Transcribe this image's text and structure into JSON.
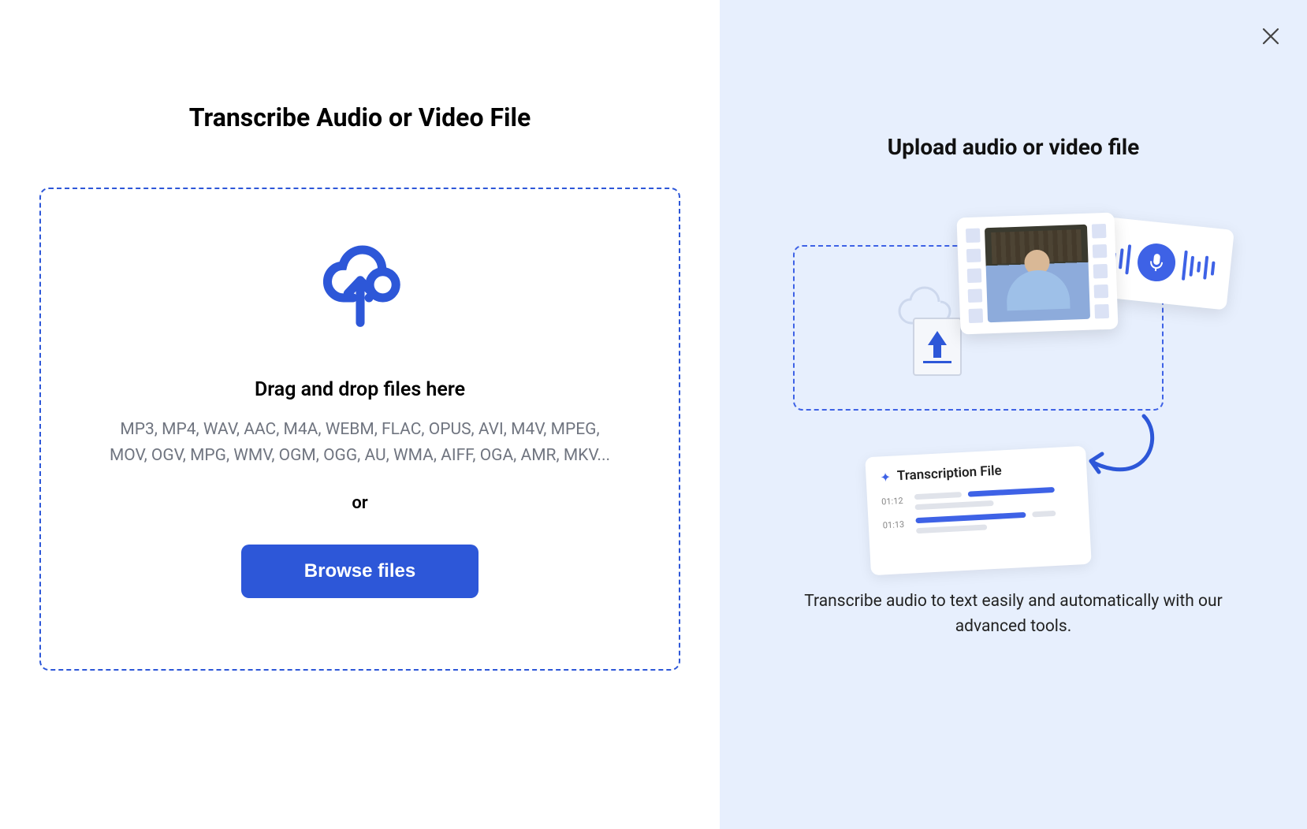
{
  "left": {
    "title": "Transcribe Audio or Video File",
    "drop_heading": "Drag and drop files here",
    "formats": "MP3, MP4, WAV, AAC, M4A, WEBM, FLAC, OPUS, AVI, M4V, MPEG, MOV, OGV, MPG, WMV, OGM, OGG, AU, WMA, AIFF, OGA, AMR, MKV...",
    "or": "or",
    "browse_btn": "Browse files"
  },
  "right": {
    "title": "Upload audio or video file",
    "description": "Transcribe audio to text easily and automatically with our advanced tools.",
    "transcription_card": {
      "title": "Transcription File",
      "time1": "01:12",
      "time2": "01:13"
    }
  }
}
